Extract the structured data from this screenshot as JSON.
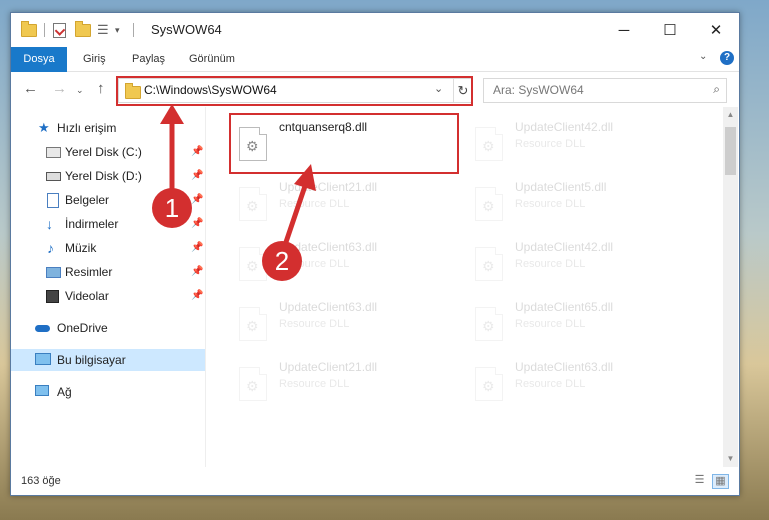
{
  "window": {
    "title": "SysWOW64"
  },
  "ribbon": {
    "tabs": [
      "Dosya",
      "Giriş",
      "Paylaş",
      "Görünüm"
    ]
  },
  "address": {
    "path": "C:\\Windows\\SysWOW64"
  },
  "search": {
    "placeholder": "Ara: SysWOW64"
  },
  "sidebar": {
    "items": [
      {
        "label": "Hızlı erişim",
        "icon": "star-icon"
      },
      {
        "label": "Yerel Disk (C:)",
        "icon": "drive-icon",
        "pinned": true
      },
      {
        "label": "Yerel Disk (D:)",
        "icon": "drive-icon",
        "pinned": true
      },
      {
        "label": "Belgeler",
        "icon": "documents-icon",
        "pinned": true
      },
      {
        "label": "İndirmeler",
        "icon": "download-icon",
        "pinned": true
      },
      {
        "label": "Müzik",
        "icon": "music-icon",
        "pinned": true
      },
      {
        "label": "Resimler",
        "icon": "pictures-icon",
        "pinned": true
      },
      {
        "label": "Videolar",
        "icon": "video-icon",
        "pinned": true
      },
      {
        "label": "OneDrive",
        "icon": "cloud-icon"
      },
      {
        "label": "Bu bilgisayar",
        "icon": "computer-icon",
        "selected": true
      },
      {
        "label": "Ağ",
        "icon": "network-icon"
      }
    ]
  },
  "files": [
    {
      "name": "cntquanserq8.dll",
      "type": ""
    },
    {
      "name": "UpdateClient42.dll",
      "type": "Resource DLL"
    },
    {
      "name": "UpdateClient21.dll",
      "type": "Resource DLL"
    },
    {
      "name": "UpdateClient5.dll",
      "type": "Resource DLL"
    },
    {
      "name": "UpdateClient63.dll",
      "type": "Resource DLL"
    },
    {
      "name": "UpdateClient42.dll",
      "type": "Resource DLL"
    },
    {
      "name": "UpdateClient63.dll",
      "type": "Resource DLL"
    },
    {
      "name": "UpdateClient65.dll",
      "type": "Resource DLL"
    },
    {
      "name": "UpdateClient21.dll",
      "type": "Resource DLL"
    },
    {
      "name": "UpdateClient63.dll",
      "type": "Resource DLL"
    }
  ],
  "status": {
    "count": "163 öğe"
  },
  "callouts": [
    "1",
    "2"
  ],
  "colors": {
    "accent": "#1979ca",
    "highlight": "#d32f2f"
  }
}
